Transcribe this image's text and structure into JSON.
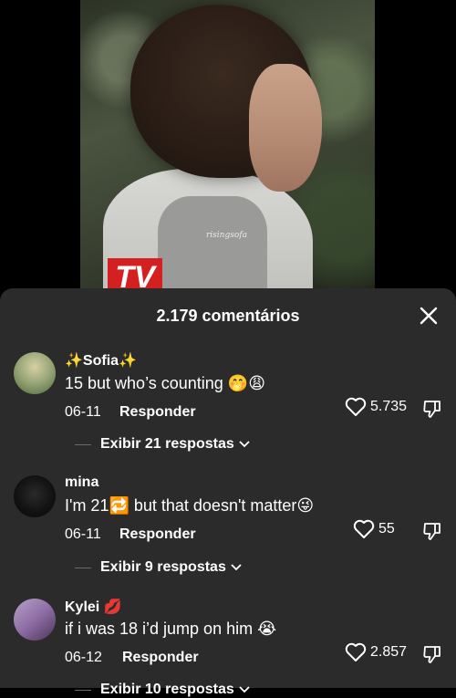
{
  "video": {
    "logo_text": "TV",
    "watermark": "risingsofa"
  },
  "sheet": {
    "title": "2.179 comentários"
  },
  "comments": [
    {
      "username": "✨Sofia✨",
      "text": "15 but who’s counting 🤭😩",
      "date": "06-11",
      "reply_label": "Responder",
      "likes": "5.735",
      "replies_label": "Exibir 21 respostas"
    },
    {
      "username": "mina",
      "text": "I'm 21🔁 but that doesn't matter😜",
      "date": "06-11",
      "reply_label": "Responder",
      "likes": "55",
      "replies_label": "Exibir 9 respostas"
    },
    {
      "username": "Kylei 💋",
      "text": "if i was 18 i’d jump on him 😭",
      "date": "06-12",
      "reply_label": "Responder",
      "likes": "2.857",
      "replies_label": "Exibir 10 respostas"
    }
  ]
}
